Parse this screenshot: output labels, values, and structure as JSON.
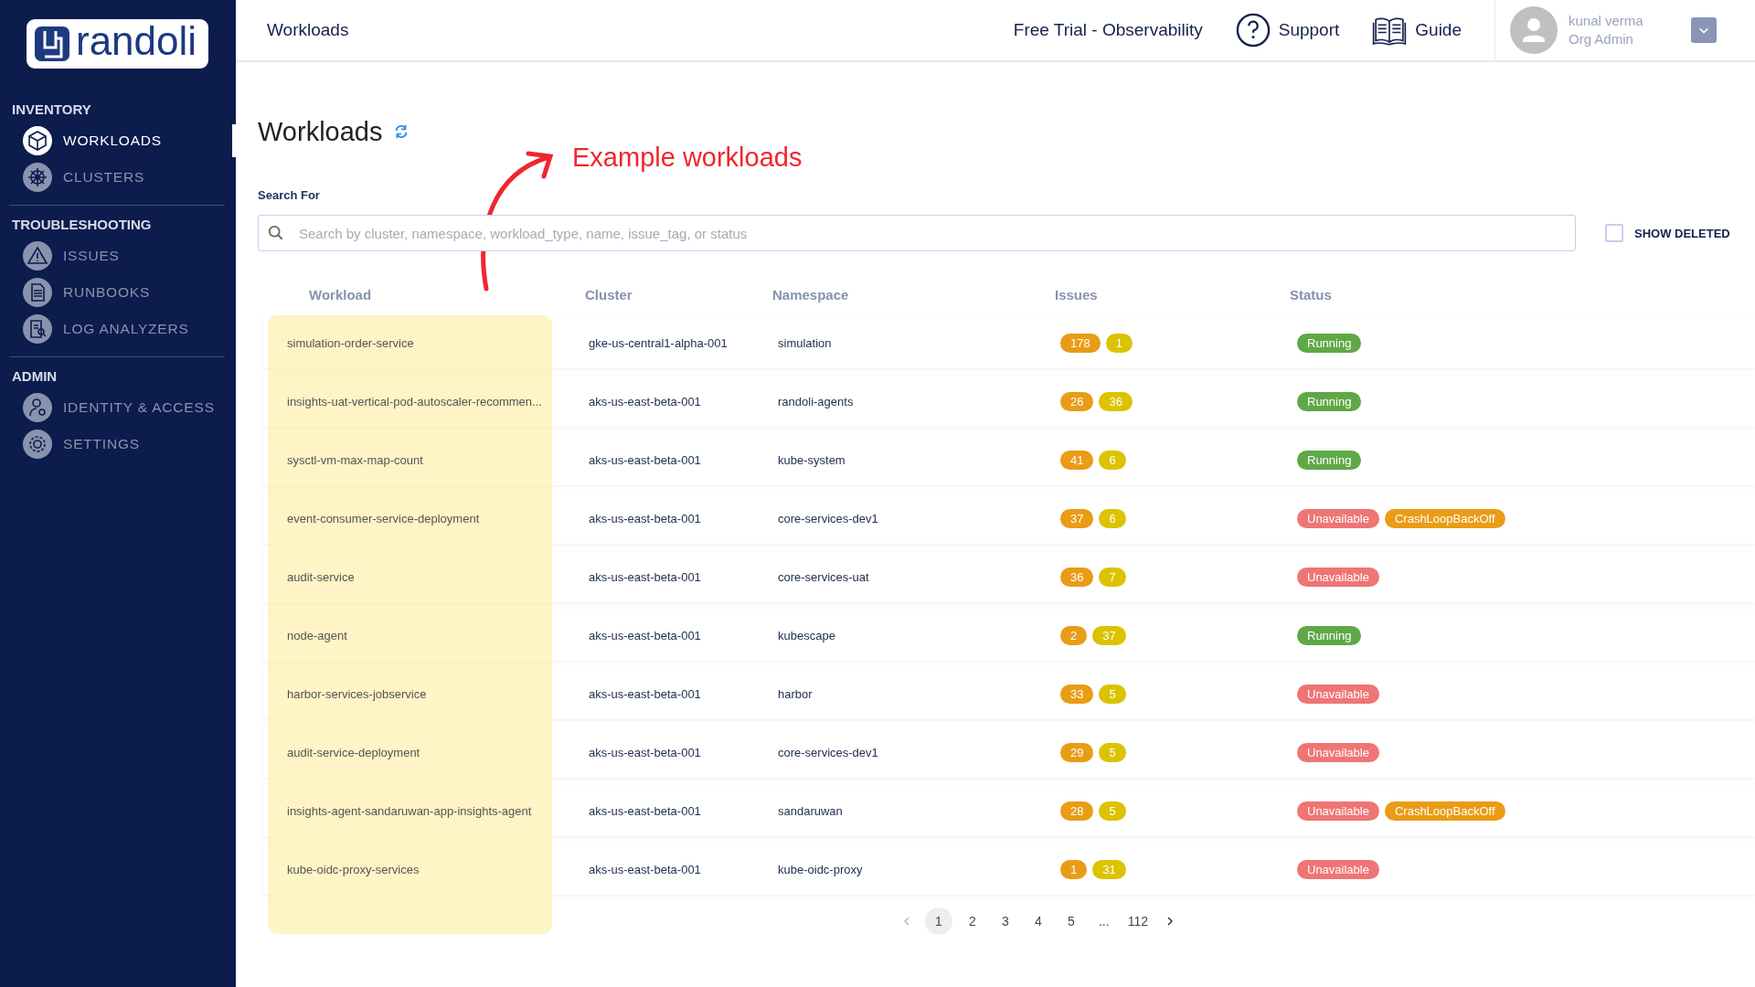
{
  "logo": {
    "text": "randoli"
  },
  "sidebar": {
    "sections": [
      {
        "title": "INVENTORY",
        "items": [
          {
            "label": "WORKLOADS",
            "selected": true
          },
          {
            "label": "CLUSTERS",
            "selected": false
          }
        ]
      },
      {
        "title": "TROUBLESHOOTING",
        "items": [
          {
            "label": "ISSUES",
            "selected": false
          },
          {
            "label": "RUNBOOKS",
            "selected": false
          },
          {
            "label": "LOG ANALYZERS",
            "selected": false
          }
        ]
      },
      {
        "title": "ADMIN",
        "items": [
          {
            "label": "IDENTITY & ACCESS",
            "selected": false
          },
          {
            "label": "SETTINGS",
            "selected": false
          }
        ]
      }
    ]
  },
  "header": {
    "breadcrumb": "Workloads",
    "trial": "Free Trial - Observability",
    "support": "Support",
    "guide": "Guide",
    "user": {
      "name": "kunal verma",
      "role": "Org Admin"
    }
  },
  "page": {
    "title": "Workloads",
    "annotation": "Example workloads",
    "search": {
      "label": "Search For",
      "placeholder": "Search by cluster, namespace, workload_type, name, issue_tag, or status"
    },
    "show_deleted": {
      "label": "SHOW DELETED",
      "checked": false
    }
  },
  "table": {
    "columns": [
      "Workload",
      "Cluster",
      "Namespace",
      "Issues",
      "Status"
    ],
    "rows": [
      {
        "workload": "simulation-order-service",
        "cluster": "gke-us-central1-alpha-001",
        "namespace": "simulation",
        "issues": [
          {
            "count": "178",
            "kind": "high"
          },
          {
            "count": "1",
            "kind": "medium"
          }
        ],
        "status": [
          {
            "label": "Running",
            "kind": "running"
          }
        ]
      },
      {
        "workload": "insights-uat-vertical-pod-autoscaler-recommen...",
        "cluster": "aks-us-east-beta-001",
        "namespace": "randoli-agents",
        "issues": [
          {
            "count": "26",
            "kind": "high"
          },
          {
            "count": "36",
            "kind": "medium"
          }
        ],
        "status": [
          {
            "label": "Running",
            "kind": "running"
          }
        ]
      },
      {
        "workload": "sysctl-vm-max-map-count",
        "cluster": "aks-us-east-beta-001",
        "namespace": "kube-system",
        "issues": [
          {
            "count": "41",
            "kind": "high"
          },
          {
            "count": "6",
            "kind": "medium"
          }
        ],
        "status": [
          {
            "label": "Running",
            "kind": "running"
          }
        ]
      },
      {
        "workload": "event-consumer-service-deployment",
        "cluster": "aks-us-east-beta-001",
        "namespace": "core-services-dev1",
        "issues": [
          {
            "count": "37",
            "kind": "high"
          },
          {
            "count": "6",
            "kind": "medium"
          }
        ],
        "status": [
          {
            "label": "Unavailable",
            "kind": "unavailable"
          },
          {
            "label": "CrashLoopBackOff",
            "kind": "crashloop"
          }
        ]
      },
      {
        "workload": "audit-service",
        "cluster": "aks-us-east-beta-001",
        "namespace": "core-services-uat",
        "issues": [
          {
            "count": "36",
            "kind": "high"
          },
          {
            "count": "7",
            "kind": "medium"
          }
        ],
        "status": [
          {
            "label": "Unavailable",
            "kind": "unavailable"
          }
        ]
      },
      {
        "workload": "node-agent",
        "cluster": "aks-us-east-beta-001",
        "namespace": "kubescape",
        "issues": [
          {
            "count": "2",
            "kind": "high"
          },
          {
            "count": "37",
            "kind": "medium"
          }
        ],
        "status": [
          {
            "label": "Running",
            "kind": "running"
          }
        ]
      },
      {
        "workload": "harbor-services-jobservice",
        "cluster": "aks-us-east-beta-001",
        "namespace": "harbor",
        "issues": [
          {
            "count": "33",
            "kind": "high"
          },
          {
            "count": "5",
            "kind": "medium"
          }
        ],
        "status": [
          {
            "label": "Unavailable",
            "kind": "unavailable"
          }
        ]
      },
      {
        "workload": "audit-service-deployment",
        "cluster": "aks-us-east-beta-001",
        "namespace": "core-services-dev1",
        "issues": [
          {
            "count": "29",
            "kind": "high"
          },
          {
            "count": "5",
            "kind": "medium"
          }
        ],
        "status": [
          {
            "label": "Unavailable",
            "kind": "unavailable"
          }
        ]
      },
      {
        "workload": "insights-agent-sandaruwan-app-insights-agent",
        "cluster": "aks-us-east-beta-001",
        "namespace": "sandaruwan",
        "issues": [
          {
            "count": "28",
            "kind": "high"
          },
          {
            "count": "5",
            "kind": "medium"
          }
        ],
        "status": [
          {
            "label": "Unavailable",
            "kind": "unavailable"
          },
          {
            "label": "CrashLoopBackOff",
            "kind": "crashloop"
          }
        ]
      },
      {
        "workload": "kube-oidc-proxy-services",
        "cluster": "aks-us-east-beta-001",
        "namespace": "kube-oidc-proxy",
        "issues": [
          {
            "count": "1",
            "kind": "high"
          },
          {
            "count": "31",
            "kind": "medium"
          }
        ],
        "status": [
          {
            "label": "Unavailable",
            "kind": "unavailable"
          }
        ]
      }
    ]
  },
  "pagination": {
    "prev_disabled": true,
    "pages": [
      {
        "label": "1",
        "selected": true
      },
      {
        "label": "2",
        "selected": false
      },
      {
        "label": "3",
        "selected": false
      },
      {
        "label": "4",
        "selected": false
      },
      {
        "label": "5",
        "selected": false
      },
      {
        "label": "...",
        "selected": false
      },
      {
        "label": "112",
        "selected": false
      }
    ]
  }
}
